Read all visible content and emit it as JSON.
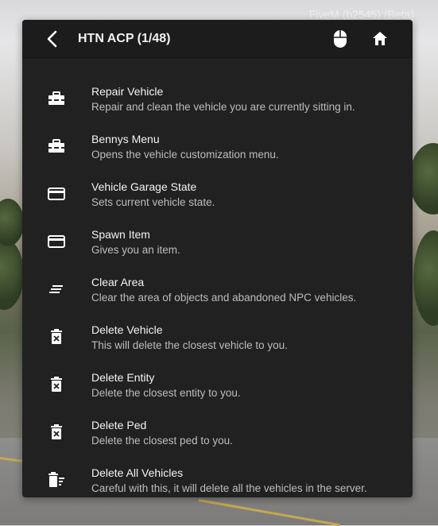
{
  "watermark": "FiveM (b2545) (Beta)",
  "header": {
    "title": "HTN ACP (1/48)"
  },
  "items": [
    {
      "label": "Repair Vehicle",
      "desc": "Repair and clean the vehicle you are currently sitting in.",
      "icon": "toolbox-icon"
    },
    {
      "label": "Bennys Menu",
      "desc": "Opens the vehicle customization menu.",
      "icon": "toolbox-icon"
    },
    {
      "label": "Vehicle Garage State",
      "desc": "Sets current vehicle state.",
      "icon": "card-icon"
    },
    {
      "label": "Spawn Item",
      "desc": "Gives you an item.",
      "icon": "card-icon"
    },
    {
      "label": "Clear Area",
      "desc": "Clear the area of objects and abandoned NPC vehicles.",
      "icon": "clear-lines-icon"
    },
    {
      "label": "Delete Vehicle",
      "desc": "This will delete the closest vehicle to you.",
      "icon": "delete-box-icon"
    },
    {
      "label": "Delete Entity",
      "desc": "Delete the closest entity to you.",
      "icon": "delete-box-icon"
    },
    {
      "label": "Delete Ped",
      "desc": "Delete the closest ped to you.",
      "icon": "delete-box-icon"
    },
    {
      "label": "Delete All Vehicles",
      "desc": "Careful with this, it will delete all the vehicles in the server.",
      "icon": "delete-sweep-icon"
    }
  ]
}
